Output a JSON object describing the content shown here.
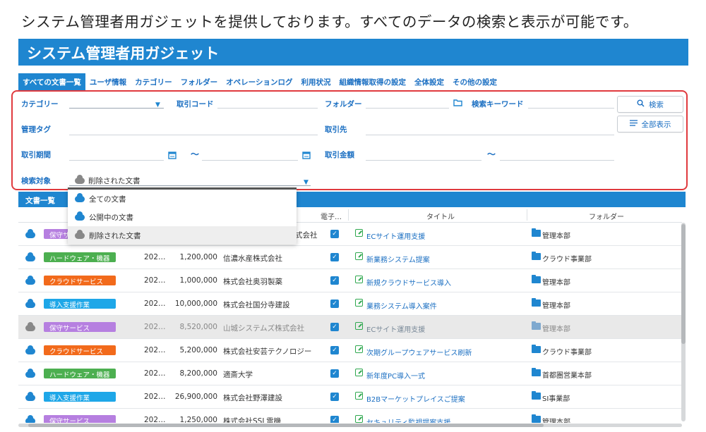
{
  "caption": "システム管理者用ガジェットを提供しております。すべてのデータの検索と表示が可能です。",
  "banner_title": "システム管理者用ガジェット",
  "tabs": [
    {
      "label": "すべての文書一覧",
      "active": true
    },
    {
      "label": "ユーザ情報"
    },
    {
      "label": "カテゴリー"
    },
    {
      "label": "フォルダー"
    },
    {
      "label": "オペレーションログ"
    },
    {
      "label": "利用状況"
    },
    {
      "label": "組織情報取得の設定"
    },
    {
      "label": "全体設定"
    },
    {
      "label": "その他の設定"
    }
  ],
  "search": {
    "category_label": "カテゴリー",
    "deal_code_label": "取引コード",
    "folder_label": "フォルダー",
    "keyword_label": "検索キーワード",
    "tag_label": "管理タグ",
    "partner_label": "取引先",
    "period_label": "取引期間",
    "amount_label": "取引金額",
    "target_label": "検索対象",
    "range_sep": "〜",
    "target_value": "削除された文書",
    "search_button": "検索",
    "show_all_button": "全部表示"
  },
  "dropdown_options": [
    "全ての文書",
    "公開中の文書",
    "削除された文書"
  ],
  "list_title": "文書一覧",
  "columns": {
    "esign": "電子…",
    "title": "タイトル",
    "folder": "フォルダー"
  },
  "rows": [
    {
      "category": "保守サービス",
      "cat_color": "#b67fe0",
      "date": "",
      "amount": "",
      "partner": "式会社",
      "title": "ECサイト運用支援",
      "folder": "管理本部",
      "deleted": false
    },
    {
      "category": "ハードウェア・機器",
      "cat_color": "#4caf50",
      "date": "202…",
      "amount": "1,200,000",
      "partner": "信濃水産株式会社",
      "title": "新業務システム提案",
      "folder": "クラウド事業部",
      "deleted": false
    },
    {
      "category": "クラウドサービス",
      "cat_color": "#f26a1b",
      "date": "202…",
      "amount": "1,000,000",
      "partner": "株式会社奥羽製薬",
      "title": "新規クラウドサービス導入",
      "folder": "管理本部",
      "deleted": false
    },
    {
      "category": "導入支援作業",
      "cat_color": "#1ea7e8",
      "date": "202…",
      "amount": "10,000,000",
      "partner": "株式会社国分寺建設",
      "title": "業務システム導入案件",
      "folder": "管理本部",
      "deleted": false
    },
    {
      "category": "保守サービス",
      "cat_color": "#b67fe0",
      "date": "202…",
      "amount": "8,520,000",
      "partner": "山城システムズ株式会社",
      "title": "ECサイト運用支援",
      "folder": "管理本部",
      "deleted": true
    },
    {
      "category": "クラウドサービス",
      "cat_color": "#f26a1b",
      "date": "202…",
      "amount": "5,200,000",
      "partner": "株式会社安芸テクノロジー",
      "title": "次期グループウェアサービス刷新",
      "folder": "クラウド事業部",
      "deleted": false
    },
    {
      "category": "ハードウェア・機器",
      "cat_color": "#4caf50",
      "date": "202…",
      "amount": "8,200,000",
      "partner": "適斎大学",
      "title": "新年度PC導入一式",
      "folder": "首都圏営業本部",
      "deleted": false
    },
    {
      "category": "導入支援作業",
      "cat_color": "#1ea7e8",
      "date": "202…",
      "amount": "26,900,000",
      "partner": "株式会社野澤建設",
      "title": "B2Bマーケットプレイスご提案",
      "folder": "SI事業部",
      "deleted": false
    },
    {
      "category": "保守サービス",
      "cat_color": "#b67fe0",
      "date": "202…",
      "amount": "1,250,000",
      "partner": "株式会社SSL電機",
      "title": "セキュリティ監視提案支援",
      "folder": "管理本部",
      "deleted": false
    }
  ]
}
